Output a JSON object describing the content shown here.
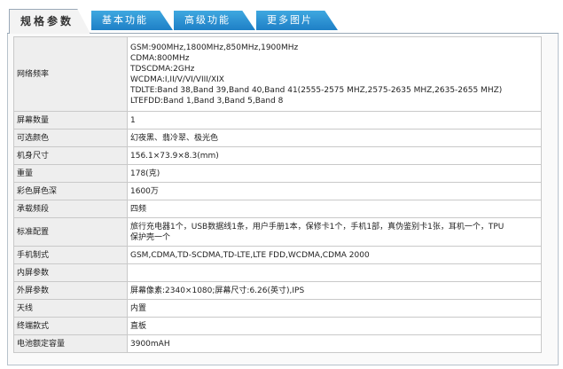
{
  "tabs": [
    {
      "label": "规格参数",
      "active": true
    },
    {
      "label": "基本功能",
      "active": false
    },
    {
      "label": "高级功能",
      "active": false
    },
    {
      "label": "更多图片",
      "active": false
    }
  ],
  "specs": [
    {
      "label": "网络频率",
      "lines": [
        "GSM:900MHz,1800MHz,850MHz,1900MHz",
        "CDMA:800MHz",
        "TDSCDMA:2GHz",
        "WCDMA:I,II/V/VI/VIII/XIX",
        "TDLTE:Band 38,Band 39,Band 40,Band 41(2555-2575 MHZ,2575-2635 MHZ,2635-2655 MHZ)",
        "LTEFDD:Band 1,Band 3,Band 5,Band 8"
      ]
    },
    {
      "label": "屏幕数量",
      "lines": [
        "1"
      ]
    },
    {
      "label": "可选颜色",
      "lines": [
        "幻夜黑、翡冷翠、极光色"
      ]
    },
    {
      "label": "机身尺寸",
      "lines": [
        "156.1×73.9×8.3(mm)"
      ]
    },
    {
      "label": "重量",
      "lines": [
        "178(克)"
      ]
    },
    {
      "label": "彩色屏色深",
      "lines": [
        "1600万"
      ]
    },
    {
      "label": "承载频段",
      "lines": [
        "四频"
      ]
    },
    {
      "label": "标准配置",
      "lines": [
        "旅行充电器1个，USB数据线1条，用户手册1本，保修卡1个，手机1部，真伪鉴别卡1张，耳机一个，TPU",
        "保护壳一个"
      ]
    },
    {
      "label": "手机制式",
      "lines": [
        "GSM,CDMA,TD-SCDMA,TD-LTE,LTE FDD,WCDMA,CDMA 2000"
      ]
    },
    {
      "label": "内屏参数",
      "lines": [
        ""
      ]
    },
    {
      "label": "外屏参数",
      "lines": [
        "屏幕像素:2340×1080;屏幕尺寸:6.26(英寸),IPS"
      ]
    },
    {
      "label": "天线",
      "lines": [
        "内置"
      ]
    },
    {
      "label": "终端款式",
      "lines": [
        "直板"
      ]
    },
    {
      "label": "电池额定容量",
      "lines": [
        "3900mAH"
      ]
    }
  ]
}
